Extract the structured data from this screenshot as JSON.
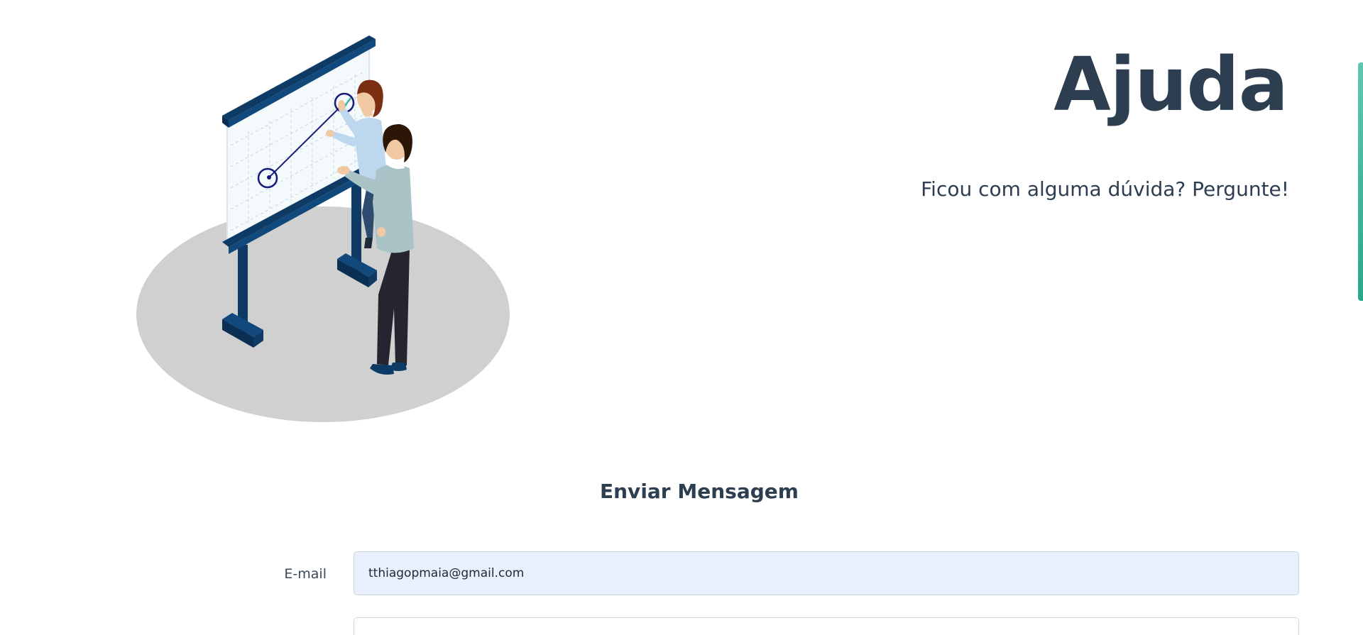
{
  "hero": {
    "title": "Ajuda",
    "subtitle": "Ficou com alguma dúvida? Pergunte!"
  },
  "illustration": {
    "name": "whiteboard-meeting-illustration"
  },
  "form": {
    "title": "Enviar Mensagem",
    "email_label": "E-mail",
    "email_value": "tthiagopmaia@gmail.com",
    "second_value": ""
  },
  "colors": {
    "text": "#2c3e50",
    "accent": "#2aa889",
    "input_autofill": "#e8f0fe",
    "board_frame": "#0d3b66",
    "floor_shadow": "#d0d0d0"
  }
}
